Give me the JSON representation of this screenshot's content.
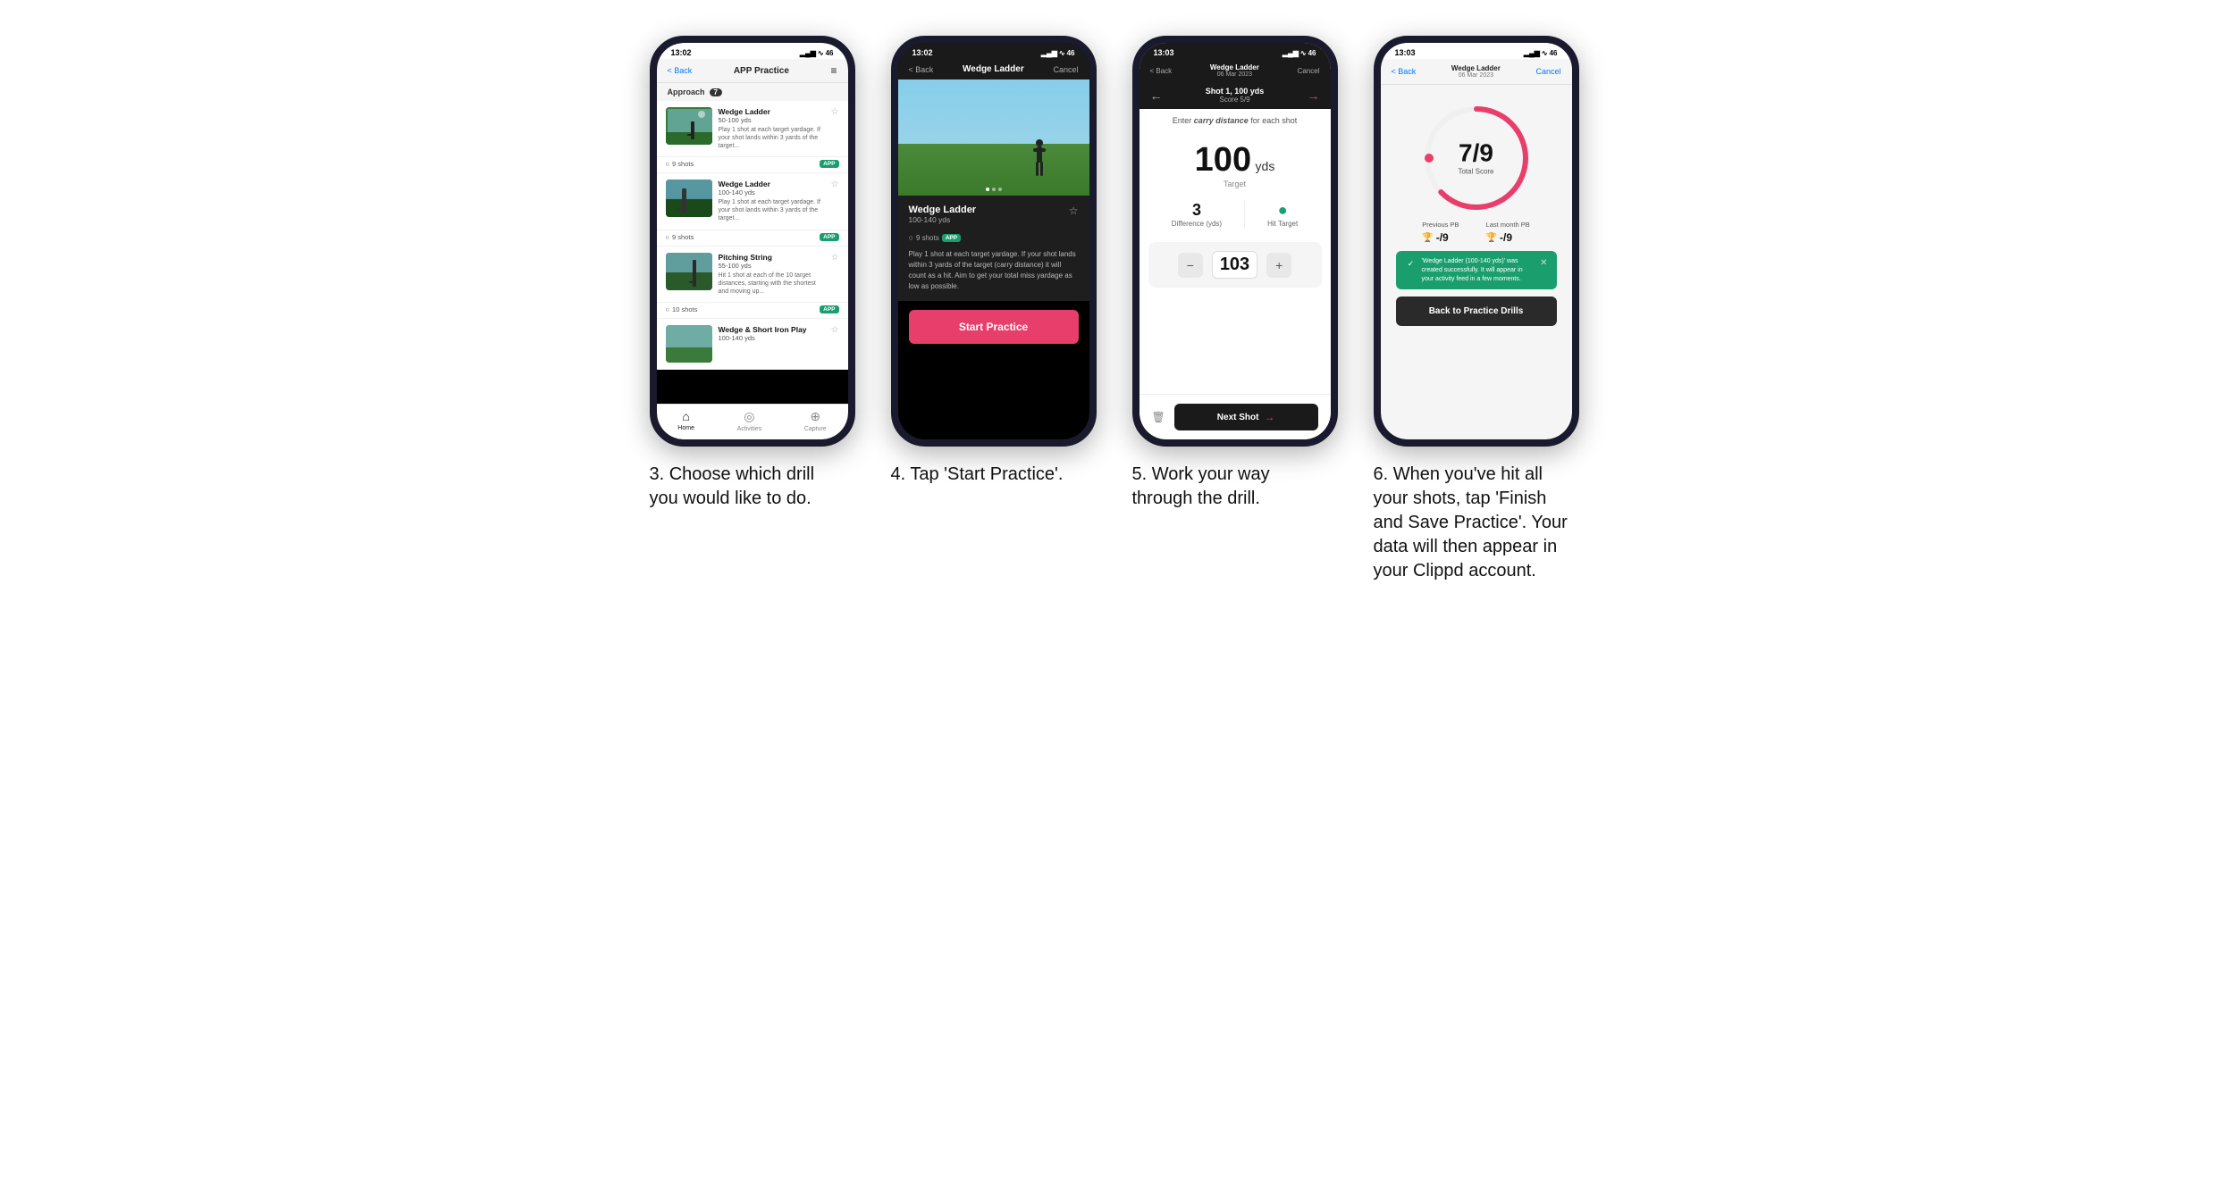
{
  "phones": [
    {
      "id": "phone3",
      "caption": "3. Choose which drill you would like to do.",
      "statusBar": {
        "time": "13:02",
        "signal": "▂▄▆",
        "wifi": "WiFi",
        "battery": "46"
      },
      "header": {
        "back": "< Back",
        "title": "APP Practice",
        "menu": "≡"
      },
      "sectionTag": "Approach",
      "sectionCount": "7",
      "drills": [
        {
          "title": "Wedge Ladder",
          "yds": "50-100 yds",
          "desc": "Play 1 shot at each target yardage. If your shot lands within 3 yards of the target...",
          "shots": "9 shots",
          "badge": "APP"
        },
        {
          "title": "Wedge Ladder",
          "yds": "100-140 yds",
          "desc": "Play 1 shot at each target yardage. If your shot lands within 3 yards of the target...",
          "shots": "9 shots",
          "badge": "APP"
        },
        {
          "title": "Pitching String",
          "yds": "55-100 yds",
          "desc": "Hit 1 shot at each of the 10 target distances, starting with the shortest and moving up...",
          "shots": "10 shots",
          "badge": "APP"
        },
        {
          "title": "Wedge & Short Iron Play",
          "yds": "100-140 yds",
          "desc": "",
          "shots": "",
          "badge": ""
        }
      ],
      "bottomNav": [
        {
          "icon": "⌂",
          "label": "Home",
          "active": true
        },
        {
          "icon": "◎",
          "label": "Activities",
          "active": false
        },
        {
          "icon": "+",
          "label": "Capture",
          "active": false
        }
      ]
    },
    {
      "id": "phone4",
      "caption": "4. Tap 'Start Practice'.",
      "statusBar": {
        "time": "13:02",
        "signal": "▂▄▆",
        "wifi": "WiFi",
        "battery": "46"
      },
      "header": {
        "back": "< Back",
        "title": "Wedge Ladder",
        "cancel": "Cancel"
      },
      "drillDetail": {
        "title": "Wedge Ladder",
        "yds": "100-140 yds",
        "shots": "9 shots",
        "badge": "APP",
        "desc": "Play 1 shot at each target yardage. If your shot lands within 3 yards of the target (carry distance) it will count as a hit. Aim to get your total miss yardage as low as possible."
      },
      "startButton": "Start Practice"
    },
    {
      "id": "phone5",
      "caption": "5. Work your way through the drill.",
      "statusBar": {
        "time": "13:03",
        "signal": "▂▄▆",
        "wifi": "WiFi",
        "battery": "46"
      },
      "header": {
        "back": "< Back",
        "titleLine1": "Wedge Ladder",
        "titleLine2": "06 Mar 2023",
        "cancel": "Cancel"
      },
      "shotNav": {
        "shotLabel": "Shot 1, 100 yds",
        "scoreLabel": "Score 5/9"
      },
      "carryLabel": "Enter carry distance for each shot",
      "target": {
        "value": "100",
        "unit": "yds",
        "label": "Target"
      },
      "stats": {
        "difference": "3",
        "differenceLabel": "Difference (yds)",
        "hitTarget": "Hit Target"
      },
      "inputValue": "103",
      "nextButton": "Next Shot"
    },
    {
      "id": "phone6",
      "caption": "6. When you've hit all your shots, tap 'Finish and Save Practice'. Your data will then appear in your Clippd account.",
      "statusBar": {
        "time": "13:03",
        "signal": "▂▄▆",
        "wifi": "WiFi",
        "battery": "46"
      },
      "header": {
        "back": "< Back",
        "titleLine1": "Wedge Ladder",
        "titleLine2": "06 Mar 2023",
        "cancel": "Cancel"
      },
      "score": {
        "value": "7/9",
        "label": "Total Score"
      },
      "previousPB": {
        "label": "Previous PB",
        "value": "-/9"
      },
      "lastMonthPB": {
        "label": "Last month PB",
        "value": "-/9"
      },
      "successBanner": "'Wedge Ladder (100-140 yds)' was created successfully. It will appear in your activity feed in a few moments.",
      "backButton": "Back to Practice Drills"
    }
  ]
}
